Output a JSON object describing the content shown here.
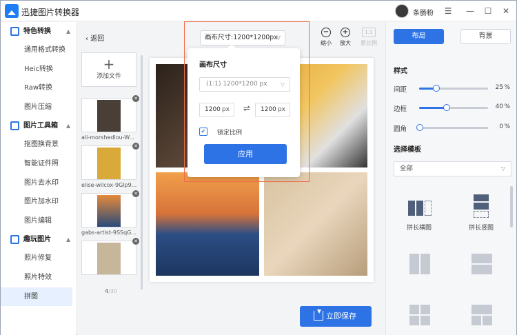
{
  "app": {
    "title": "迅捷图片转换器",
    "username": "条肠粉",
    "window_controls": [
      "☰",
      "—",
      "☐",
      "✕"
    ]
  },
  "sidebar": {
    "groups": [
      {
        "label": "特色转换",
        "items": [
          "通用格式转换",
          "Heic转换",
          "Raw转换",
          "图片压缩"
        ]
      },
      {
        "label": "图片工具箱",
        "items": [
          "抠图换背景",
          "智能证件照",
          "图片去水印",
          "图片加水印",
          "图片编辑"
        ]
      },
      {
        "label": "趣玩图片",
        "items": [
          "照片修复",
          "照片特效",
          "拼图"
        ]
      }
    ],
    "active_item": "拼图"
  },
  "toolbar": {
    "back_label": "返回",
    "canvas_size_label": "画布尺寸:1200*1200px",
    "zoom_out": "缩小",
    "zoom_in": "放大",
    "original_ratio_icon": "1:1",
    "original_ratio": "原比例"
  },
  "files": {
    "add_label": "添加文件",
    "items": [
      {
        "name": "ali-morshedlou-W...",
        "color": "#4a3f36"
      },
      {
        "name": "elise-wilcox-9Glp9...",
        "color": "#d9a93a"
      },
      {
        "name": "gabs-artist-9SSqG...",
        "color": "#e48a3a"
      },
      {
        "name": "",
        "color": "#c7b79a"
      }
    ],
    "count_current": "4",
    "count_total": "/30"
  },
  "popup": {
    "title": "画布尺寸",
    "preset": "(1:1) 1200*1200 px",
    "width_value": "1200",
    "height_value": "1200",
    "unit": "px",
    "swap_icon": "⇌",
    "lock_ratio_label": "锁定比例",
    "lock_ratio_checked": true,
    "apply_label": "应用"
  },
  "save_label": "立即保存",
  "right_panel": {
    "tab_layout": "布局",
    "tab_background": "背景",
    "style_heading": "样式",
    "sliders": [
      {
        "label": "间距",
        "value": 25,
        "unit": "%"
      },
      {
        "label": "边框",
        "value": 40,
        "unit": "%"
      },
      {
        "label": "圆角",
        "value": 0,
        "unit": "%"
      }
    ],
    "template_heading": "选择模板",
    "template_filter": "全部",
    "templates": [
      {
        "label": "拼长横图",
        "icon": "horizontal-stitch-icon"
      },
      {
        "label": "拼长竖图",
        "icon": "vertical-stitch-icon"
      }
    ]
  },
  "colors": {
    "accent": "#2e73e6",
    "highlight": "#f06b45"
  }
}
